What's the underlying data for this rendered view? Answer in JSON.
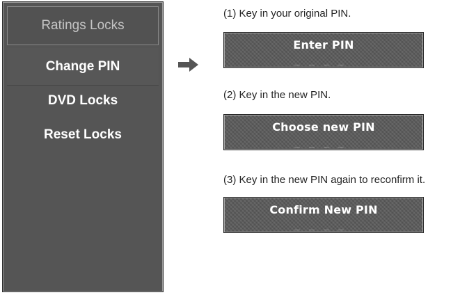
{
  "menu": {
    "header": "Ratings Locks",
    "items": [
      {
        "label": "Change PIN",
        "selected": true
      },
      {
        "label": "DVD Locks",
        "selected": false
      },
      {
        "label": "Reset Locks",
        "selected": false
      }
    ]
  },
  "arrow_icon": "right-arrow-icon",
  "steps": [
    {
      "instruction": "(1) Key in your original PIN.",
      "box_title": "Enter PIN",
      "dashes": "____"
    },
    {
      "instruction": "(2) Key in the new PIN.",
      "box_title": "Choose new PIN",
      "dashes": "____"
    },
    {
      "instruction": "(3) Key in the new PIN again to reconfirm it.",
      "box_title": "Confirm New PIN",
      "dashes": "____"
    }
  ],
  "colors": {
    "panel": "#555555",
    "pin_box": "#5a5a5a",
    "menu_text": "#ffffff",
    "header_text": "#c4c4c4"
  }
}
